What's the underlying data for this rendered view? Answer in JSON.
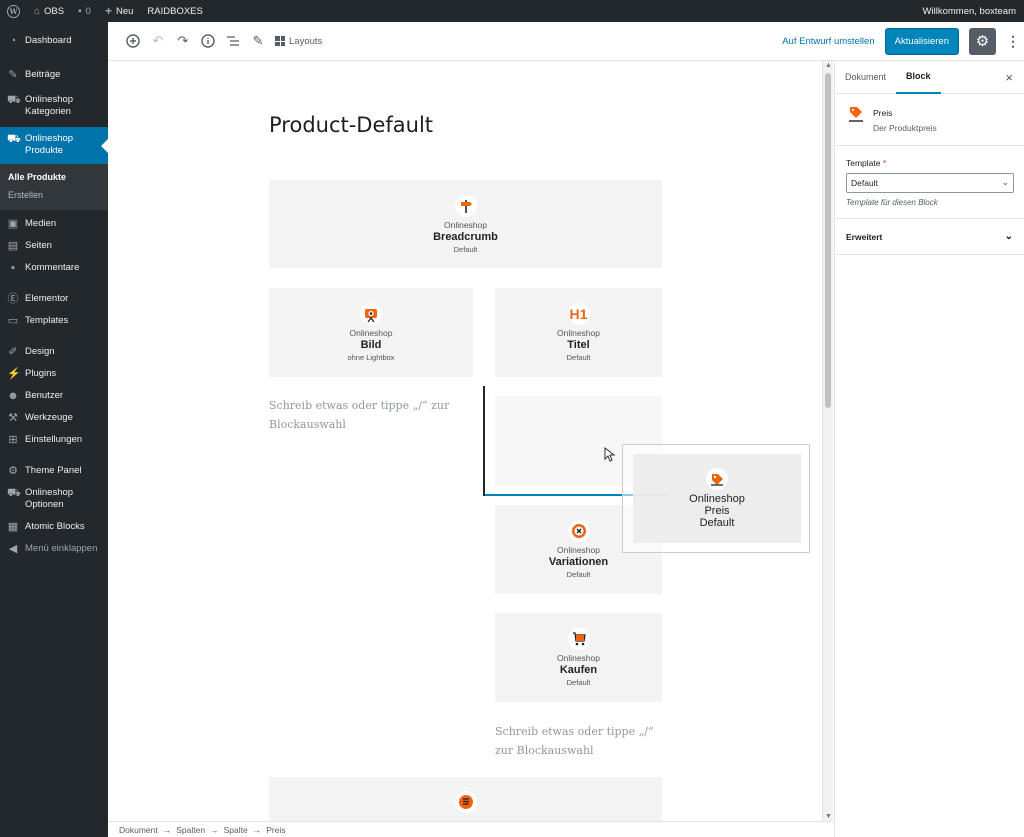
{
  "adminbar": {
    "site_name": "OBS",
    "comments_count": "0",
    "new_label": "Neu",
    "raidboxes_label": "RAIDBOXES",
    "greeting": "Willkommen, boxteam"
  },
  "sidebar": {
    "dashboard": "Dashboard",
    "beitraege": "Beiträge",
    "onlineshop_kategorien": "Onlineshop Kategorien",
    "onlineshop_produkte": "Onlineshop Produkte",
    "sub_alle_produkte": "Alle Produkte",
    "sub_erstellen": "Erstellen",
    "medien": "Medien",
    "seiten": "Seiten",
    "kommentare": "Kommentare",
    "elementor": "Elementor",
    "templates": "Templates",
    "design": "Design",
    "plugins": "Plugins",
    "benutzer": "Benutzer",
    "werkzeuge": "Werkzeuge",
    "einstellungen": "Einstellungen",
    "theme_panel": "Theme Panel",
    "onlineshop_optionen": "Onlineshop Optionen",
    "atomic_blocks": "Atomic Blocks",
    "menu_collapse": "Menü einklappen"
  },
  "toolbar": {
    "layouts_label": "Layouts",
    "draft_label": "Auf Entwurf umstellen",
    "update_label": "Aktualisieren"
  },
  "editor": {
    "post_title": "Product-Default",
    "placeholder_text": "Schreib etwas oder tippe „/“ zur Blockauswahl",
    "blocks": {
      "breadcrumb": {
        "sub": "Onlineshop",
        "name": "Breadcrumb",
        "variant": "Default"
      },
      "bild": {
        "sub": "Onlineshop",
        "name": "Bild",
        "variant": "ohne Lightbox"
      },
      "titel": {
        "sub": "Onlineshop",
        "name": "Titel",
        "variant": "Default"
      },
      "preis": {
        "sub": "Onlineshop",
        "name": "Preis",
        "variant": "Default"
      },
      "variationen": {
        "sub": "Onlineshop",
        "name": "Variationen",
        "variant": "Default"
      },
      "kaufen": {
        "sub": "Onlineshop",
        "name": "Kaufen",
        "variant": "Default"
      }
    },
    "titel_icon_text": "H1"
  },
  "breadcrumbs": [
    "Dokument",
    "Spalten",
    "Spalte",
    "Preis"
  ],
  "breadcrumb_separator": "→",
  "settings_sidebar": {
    "tab_document": "Dokument",
    "tab_block": "Block",
    "block_title": "Preis",
    "block_description": "Der Produktpreis",
    "template_label": "Template",
    "template_required": "*",
    "template_value": "Default",
    "template_help": "Template für diesen Block",
    "advanced_label": "Erweitert"
  },
  "colors": {
    "accent": "#0085ba",
    "admin_bg": "#23282d",
    "current_menu": "#0073aa",
    "icon_orange": "#f0640f"
  }
}
